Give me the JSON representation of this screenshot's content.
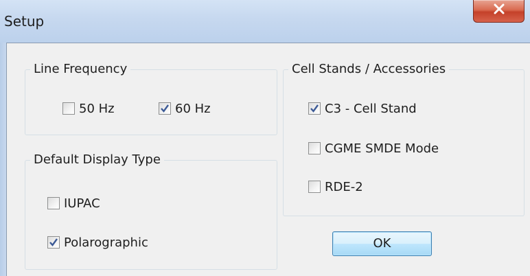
{
  "window": {
    "title": "Setup",
    "close_icon": "close-icon"
  },
  "line_frequency": {
    "label": "Line Frequency",
    "options": [
      {
        "label": "50 Hz",
        "checked": false
      },
      {
        "label": "60 Hz",
        "checked": true
      }
    ]
  },
  "display_type": {
    "label": "Default Display Type",
    "options": [
      {
        "label": "IUPAC",
        "checked": false
      },
      {
        "label": "Polarographic",
        "checked": true
      }
    ]
  },
  "cell_stands": {
    "label": "Cell Stands / Accessories",
    "options": [
      {
        "label": "C3 - Cell Stand",
        "checked": true
      },
      {
        "label": "CGME SMDE Mode",
        "checked": false
      },
      {
        "label": "RDE-2",
        "checked": false
      }
    ]
  },
  "buttons": {
    "ok_label": "OK"
  },
  "colors": {
    "check_mark": "#3c5a96",
    "close_button": "#c4412a",
    "titlebar": "#c6d8ef"
  }
}
